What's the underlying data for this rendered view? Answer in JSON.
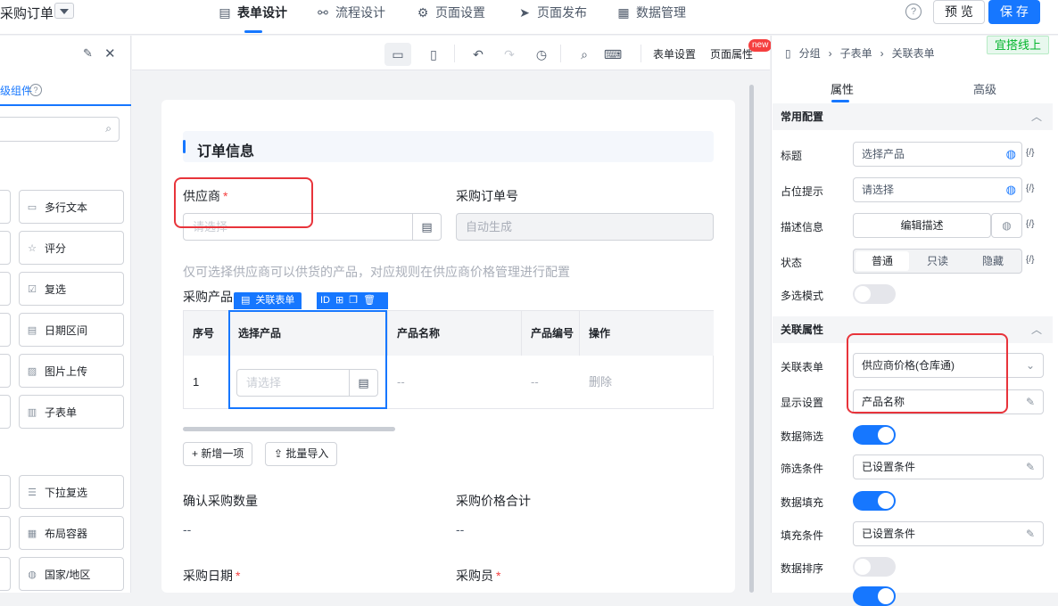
{
  "app": {
    "title": "采购订单"
  },
  "nav": {
    "tabs": [
      {
        "label": "表单设计",
        "icon": "form-icon"
      },
      {
        "label": "流程设计",
        "icon": "flow-icon"
      },
      {
        "label": "页面设置",
        "icon": "gear-icon"
      },
      {
        "label": "页面发布",
        "icon": "send-icon"
      },
      {
        "label": "数据管理",
        "icon": "grid-icon"
      }
    ],
    "help": "?",
    "preview": "预 览",
    "save": "保 存"
  },
  "left": {
    "tab": "级组件",
    "components": [
      "多行文本",
      "评分",
      "复选",
      "日期区间",
      "图片上传",
      "子表单",
      "下拉复选",
      "布局容器",
      "国家/地区"
    ]
  },
  "toolbar": {
    "form_settings": "表单设置",
    "page_props": "页面属性",
    "new_badge": "new"
  },
  "form": {
    "section_title": "订单信息",
    "supplier_label": "供应商",
    "supplier_placeholder": "请选择",
    "po_label": "采购订单号",
    "po_value": "自动生成",
    "hint": "仅可选择供应商可以供货的产品，对应规则在供应商价格管理进行配置",
    "products_label": "采购产品",
    "table": {
      "headers": [
        "序号",
        "选择产品",
        "产品名称",
        "产品编号",
        "操作"
      ],
      "row": {
        "index": "1",
        "select_placeholder": "请选择",
        "name": "--",
        "code": "--",
        "action": "删除"
      }
    },
    "selection_label": "关联表单",
    "selection_id": "ID",
    "add_row": "新增一项",
    "batch_import": "批量导入",
    "confirm_qty_label": "确认采购数量",
    "confirm_qty_value": "--",
    "total_label": "采购价格合计",
    "total_value": "--",
    "date_label": "采购日期",
    "buyer_label": "采购员"
  },
  "right": {
    "breadcrumb": [
      "分组",
      "子表单",
      "关联表单"
    ],
    "badge": "宜搭线上",
    "tabs": [
      "属性",
      "高级"
    ],
    "common_section": "常用配置",
    "title_label": "标题",
    "title_value": "选择产品",
    "placeholder_label": "占位提示",
    "placeholder_value": "请选择",
    "desc_label": "描述信息",
    "desc_button": "编辑描述",
    "state_label": "状态",
    "state_options": [
      "普通",
      "只读",
      "隐藏"
    ],
    "multi_label": "多选模式",
    "assoc_section": "关联属性",
    "assoc_form_label": "关联表单",
    "assoc_form_value": "供应商价格(仓库通)",
    "display_label": "显示设置",
    "display_value": "产品名称",
    "filter_label": "数据筛选",
    "filter_cond_label": "筛选条件",
    "filter_cond_value": "已设置条件",
    "fill_label": "数据填充",
    "fill_cond_label": "填充条件",
    "fill_cond_value": "已设置条件",
    "sort_label": "数据排序",
    "fx": "{/}"
  }
}
